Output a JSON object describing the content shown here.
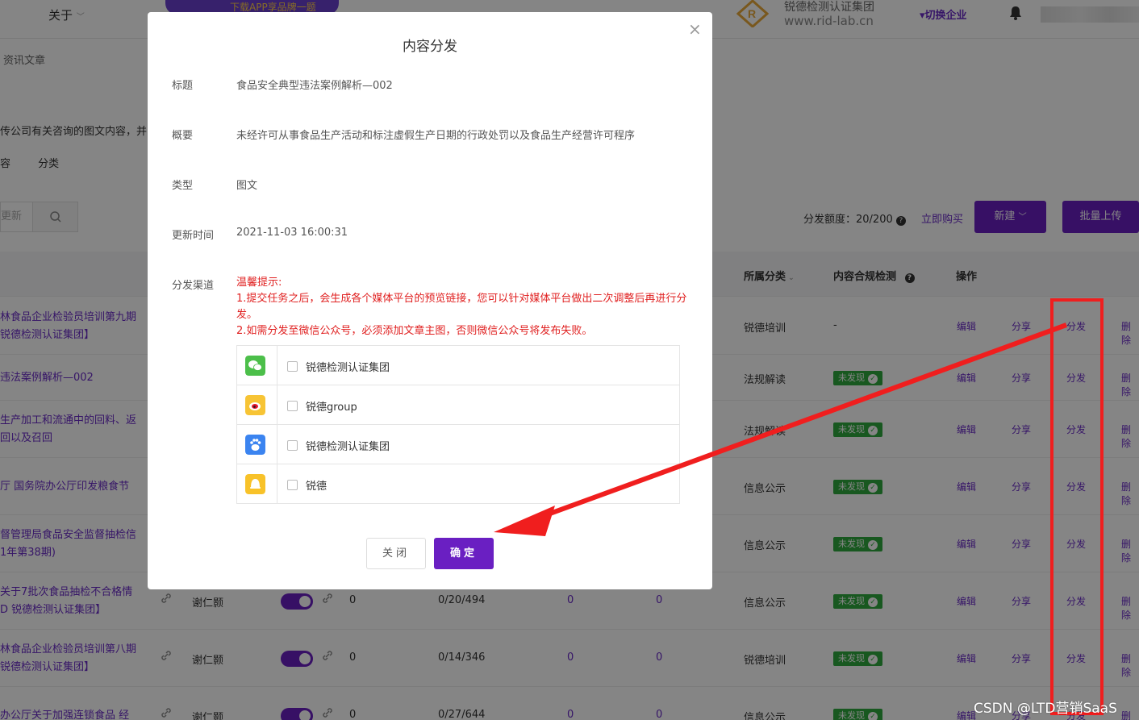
{
  "topbar": {
    "about_menu": "关于",
    "banner_text": "下载APP享品牌一题",
    "brand_name": "锐德检测认证集团",
    "brand_url": "www.rid-lab.cn",
    "switch_corp": "切换企业"
  },
  "page": {
    "breadcrumb": "资讯文章",
    "description": "传公司有关咨询的图文内容，并",
    "tabs": [
      "容",
      "分类"
    ],
    "search_placeholder": "更新",
    "quota_label": "分发额度：20/200",
    "buy_now": "立即购买",
    "new_button": "新建",
    "batch_upload": "批量上传"
  },
  "table": {
    "headers": {
      "category": "所属分类",
      "compliance": "内容合规检测",
      "actions": "操作"
    },
    "action_labels": {
      "edit": "编辑",
      "share": "分享",
      "distribute": "分发",
      "delete": "删除"
    },
    "rows": [
      {
        "title1": "林食品企业检验员培训第九期",
        "title2": "锐德检测认证集团】",
        "category": "锐德培训",
        "compliance": "-",
        "author": "",
        "views": "",
        "stats": "",
        "n1": "",
        "n2": ""
      },
      {
        "title1": "违法案例解析—002",
        "title2": "",
        "category": "法规解读",
        "compliance": "未发现",
        "author": "",
        "views": "",
        "stats": "",
        "n1": "",
        "n2": ""
      },
      {
        "title1": "生产加工和流通中的回料、返",
        "title2": "回以及召回",
        "category": "法规解读",
        "compliance": "未发现",
        "author": "",
        "views": "",
        "stats": "",
        "n1": "",
        "n2": ""
      },
      {
        "title1": "厅 国务院办公厅印发粮食节",
        "title2": "",
        "category": "信息公示",
        "compliance": "未发现",
        "author": "",
        "views": "",
        "stats": "",
        "n1": "",
        "n2": ""
      },
      {
        "title1": "督管理局食品安全监督抽检信",
        "title2": "1年第38期)",
        "category": "信息公示",
        "compliance": "未发现",
        "author": "",
        "views": "",
        "stats": "",
        "n1": "",
        "n2": ""
      },
      {
        "title1": "关于7批次食品抽检不合格情",
        "title2": "D 锐德检测认证集团】",
        "category": "信息公示",
        "compliance": "未发现",
        "author": "谢仁颢",
        "views": "0",
        "stats": "0/20/494",
        "n1": "0",
        "n2": "0"
      },
      {
        "title1": "林食品企业检验员培训第八期",
        "title2": "锐德检测认证集团】",
        "category": "锐德培训",
        "compliance": "未发现",
        "author": "谢仁颢",
        "views": "0",
        "stats": "0/14/346",
        "n1": "0",
        "n2": "0"
      },
      {
        "title1": "办公厅关于加强连锁食品 经",
        "title2": "",
        "category": "信息公示",
        "compliance": "未发现",
        "author": "谢仁颢",
        "views": "0",
        "stats": "0/27/644",
        "n1": "0",
        "n2": "0"
      }
    ]
  },
  "modal": {
    "title": "内容分发",
    "fields": {
      "title_label": "标题",
      "title_value": "食品安全典型违法案例解析—002",
      "summary_label": "概要",
      "summary_value": "未经许可从事食品生产活动和标注虚假生产日期的行政处罚以及食品生产经营许可程序",
      "type_label": "类型",
      "type_value": "图文",
      "updated_label": "更新时间",
      "updated_value": "2021-11-03 16:00:31",
      "channel_label": "分发渠道"
    },
    "warning": {
      "heading": "温馨提示:",
      "line1": "1.提交任务之后，会生成各个媒体平台的预览链接，您可以针对媒体平台做出二次调整后再进行分发。",
      "line2": "2.如需分发至微信公众号，必须添加文章主图，否则微信公众号将发布失败。"
    },
    "channels": [
      {
        "name": "锐德检测认证集团",
        "icon": "wechat-icon",
        "color": "#4cbf4a",
        "checked": false
      },
      {
        "name": "锐德group",
        "icon": "weibo-icon",
        "color": "#f7c435",
        "checked": false
      },
      {
        "name": "锐德检测认证集团",
        "icon": "baidu-icon",
        "color": "#3b84f0",
        "checked": false
      },
      {
        "name": "锐德",
        "icon": "qq-icon",
        "color": "#f8c229",
        "checked": false
      }
    ],
    "close_button": "关闭",
    "confirm_button": "确定"
  },
  "watermark": "CSDN @LTD营销SaaS",
  "colors": {
    "accent": "#6a1fc2",
    "warning": "#e02020",
    "annotation_red": "#f01e1e",
    "tag_green": "#2eaa3e"
  }
}
